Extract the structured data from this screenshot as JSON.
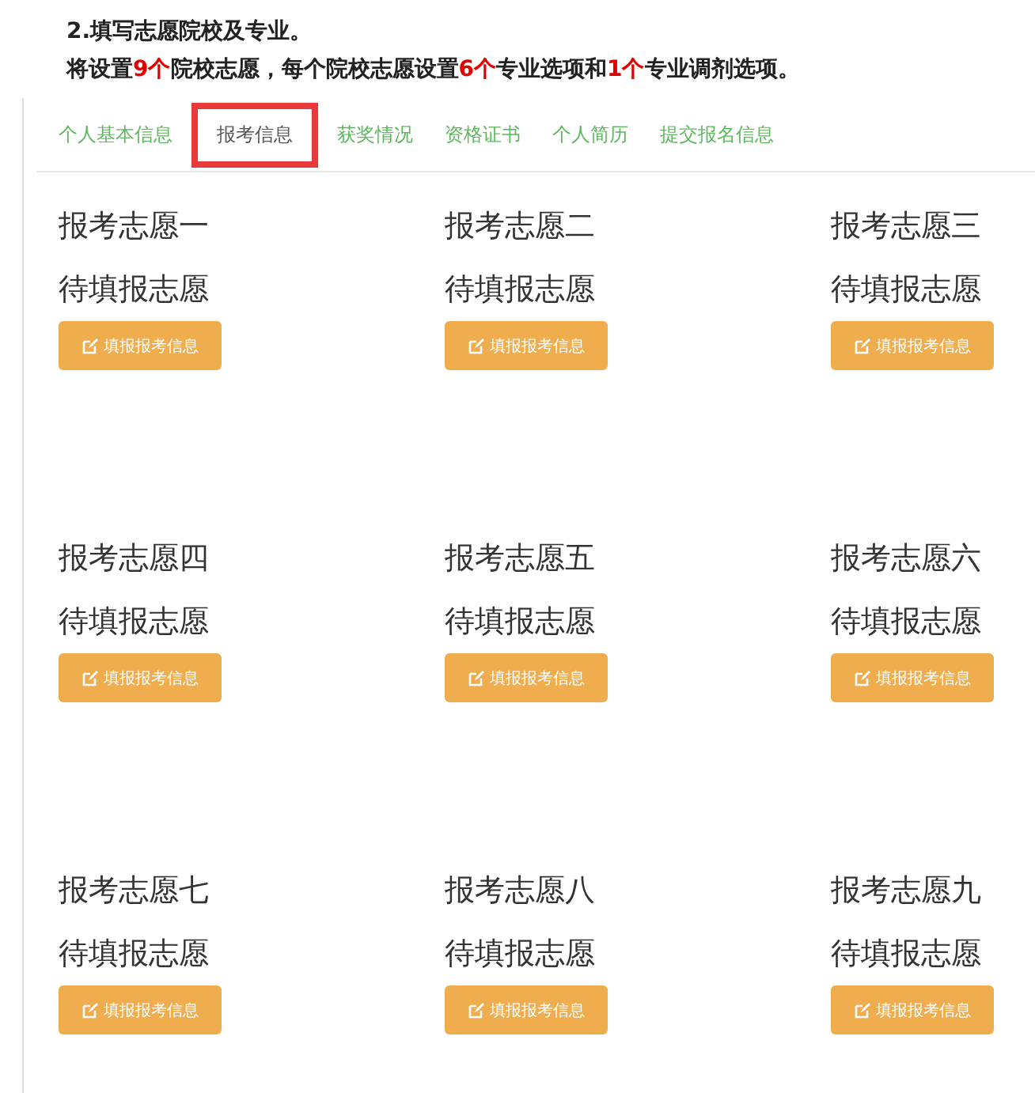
{
  "heading": "2.填写志愿院校及专业。",
  "intro": [
    {
      "text": "将设置",
      "highlight": false
    },
    {
      "text": "9个",
      "highlight": true
    },
    {
      "text": "院校志愿，每个院校志愿设置",
      "highlight": false
    },
    {
      "text": "6个",
      "highlight": true
    },
    {
      "text": "专业选项和",
      "highlight": false
    },
    {
      "text": "1个",
      "highlight": true
    },
    {
      "text": "专业调剂选项。",
      "highlight": false
    }
  ],
  "tabs": [
    {
      "label": "个人基本信息",
      "selected": false
    },
    {
      "label": "报考信息",
      "selected": true
    },
    {
      "label": "获奖情况",
      "selected": false
    },
    {
      "label": "资格证书",
      "selected": false
    },
    {
      "label": "个人简历",
      "selected": false
    },
    {
      "label": "提交报名信息",
      "selected": false
    }
  ],
  "choices": [
    {
      "title": "报考志愿一",
      "status": "待填报志愿",
      "button": "填报报考信息"
    },
    {
      "title": "报考志愿二",
      "status": "待填报志愿",
      "button": "填报报考信息"
    },
    {
      "title": "报考志愿三",
      "status": "待填报志愿",
      "button": "填报报考信息"
    },
    {
      "title": "报考志愿四",
      "status": "待填报志愿",
      "button": "填报报考信息"
    },
    {
      "title": "报考志愿五",
      "status": "待填报志愿",
      "button": "填报报考信息"
    },
    {
      "title": "报考志愿六",
      "status": "待填报志愿",
      "button": "填报报考信息"
    },
    {
      "title": "报考志愿七",
      "status": "待填报志愿",
      "button": "填报报考信息"
    },
    {
      "title": "报考志愿八",
      "status": "待填报志愿",
      "button": "填报报考信息"
    },
    {
      "title": "报考志愿九",
      "status": "待填报志愿",
      "button": "填报报考信息"
    }
  ]
}
